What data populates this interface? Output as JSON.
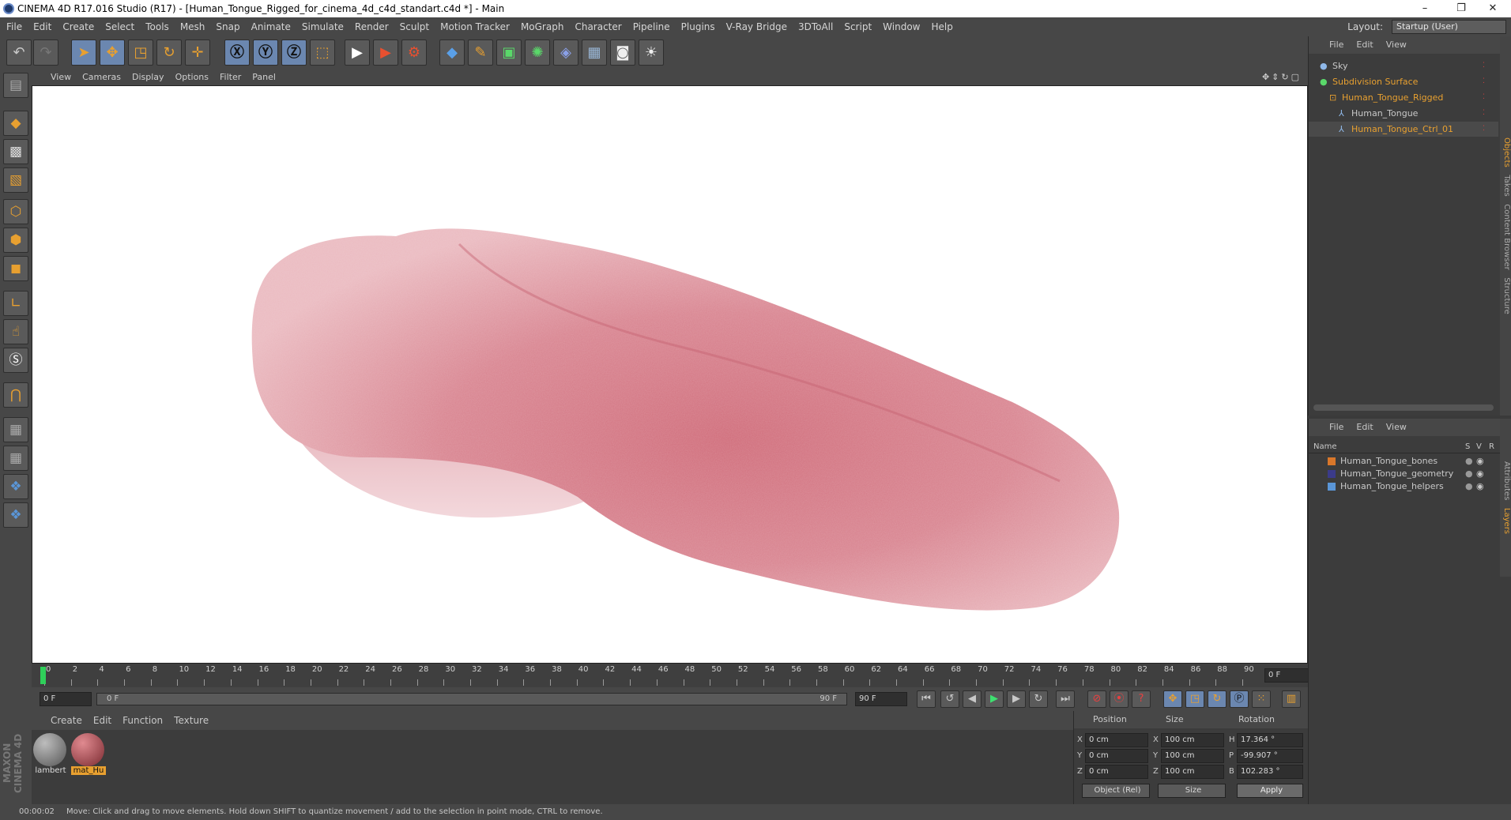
{
  "window": {
    "title": "CINEMA 4D R17.016 Studio (R17) - [Human_Tongue_Rigged_for_cinema_4d_c4d_standart.c4d *] - Main",
    "minimize": "–",
    "restore": "❐",
    "close": "✕"
  },
  "menu": [
    "File",
    "Edit",
    "Create",
    "Select",
    "Tools",
    "Mesh",
    "Snap",
    "Animate",
    "Simulate",
    "Render",
    "Sculpt",
    "Motion Tracker",
    "MoGraph",
    "Character",
    "Pipeline",
    "Plugins",
    "V-Ray Bridge",
    "3DToAll",
    "Script",
    "Window",
    "Help"
  ],
  "layout": {
    "label": "Layout:",
    "value": "Startup (User)"
  },
  "viewport_menu": [
    "View",
    "Cameras",
    "Display",
    "Options",
    "Filter",
    "Panel"
  ],
  "timeline": {
    "ticks": [
      "0",
      "2",
      "4",
      "6",
      "8",
      "10",
      "12",
      "14",
      "16",
      "18",
      "20",
      "22",
      "24",
      "26",
      "28",
      "30",
      "32",
      "34",
      "36",
      "38",
      "40",
      "42",
      "44",
      "46",
      "48",
      "50",
      "52",
      "54",
      "56",
      "58",
      "60",
      "62",
      "64",
      "66",
      "68",
      "70",
      "72",
      "74",
      "76",
      "78",
      "80",
      "82",
      "84",
      "86",
      "88",
      "90"
    ],
    "current_frame": "0 F"
  },
  "transport": {
    "start": "0 F",
    "range_start": "0 F",
    "range_end": "90 F",
    "end": "90 F"
  },
  "material_menu": [
    "Create",
    "Edit",
    "Function",
    "Texture"
  ],
  "materials": [
    {
      "name": "lambert"
    },
    {
      "name": "mat_Hu"
    }
  ],
  "attributes": {
    "headers": {
      "position": "Position",
      "size": "Size",
      "rotation": "Rotation"
    },
    "rows": [
      {
        "axis": "X",
        "pos": "0 cm",
        "saxis": "X",
        "size": "100 cm",
        "raxis": "H",
        "rot": "17.364 °"
      },
      {
        "axis": "Y",
        "pos": "0 cm",
        "saxis": "Y",
        "size": "100 cm",
        "raxis": "P",
        "rot": "-99.907 °"
      },
      {
        "axis": "Z",
        "pos": "0 cm",
        "saxis": "Z",
        "size": "100 cm",
        "raxis": "B",
        "rot": "102.283 °"
      }
    ],
    "coord_mode": "Object (Rel)",
    "size_mode": "Size",
    "apply": "Apply"
  },
  "object_menu": [
    "File",
    "Edit",
    "View"
  ],
  "objects": [
    {
      "name": "Sky",
      "color": "#c8c8c8"
    },
    {
      "name": "Subdivision Surface",
      "color": "#e8a030"
    },
    {
      "name": "Human_Tongue_Rigged",
      "color": "#e8a030"
    },
    {
      "name": "Human_Tongue",
      "color": "#c8c8c8"
    },
    {
      "name": "Human_Tongue_Ctrl_01",
      "color": "#e8a030"
    }
  ],
  "layer_menu": [
    "File",
    "Edit",
    "View"
  ],
  "layer_columns": {
    "name": "Name",
    "s": "S",
    "v": "V",
    "r": "R"
  },
  "layers": [
    {
      "name": "Human_Tongue_bones",
      "color": "#d9772a"
    },
    {
      "name": "Human_Tongue_geometry",
      "color": "#3b3b8a"
    },
    {
      "name": "Human_Tongue_helpers",
      "color": "#5a96d8"
    }
  ],
  "side_tabs": [
    "Objects",
    "Takes",
    "Content Browser",
    "Structure"
  ],
  "side_tabs_lower": [
    "Attributes",
    "Layers"
  ],
  "status": {
    "time": "00:00:02",
    "message": "Move: Click and drag to move elements. Hold down SHIFT to quantize movement / add to the selection in point mode, CTRL to remove."
  },
  "brand": "MAXON CINEMA 4D",
  "colors": {
    "accent_orange": "#e8a030",
    "selected_blue": "#6b87b0",
    "tongue": "#d9828f"
  }
}
